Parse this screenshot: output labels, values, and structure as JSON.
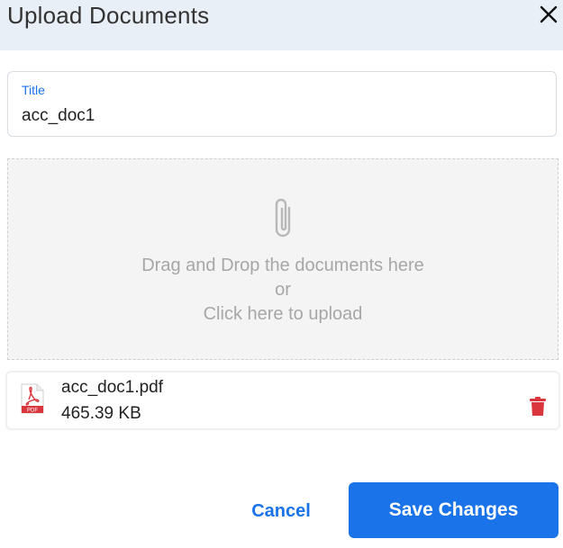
{
  "dialog": {
    "title": "Upload Documents",
    "close_icon": "close-icon"
  },
  "title_field": {
    "label": "Title",
    "value": "acc_doc1"
  },
  "dropzone": {
    "icon": "paperclip-icon",
    "line1": "Drag and Drop the documents here",
    "line2": "or",
    "line3": "Click here to upload"
  },
  "file": {
    "icon": "pdf-file-icon",
    "name": "acc_doc1.pdf",
    "size": "465.39 KB",
    "delete_icon": "trash-icon"
  },
  "actions": {
    "cancel_label": "Cancel",
    "save_label": "Save Changes"
  },
  "colors": {
    "accent": "#1a73e8",
    "header_bg": "#e9eff7",
    "danger": "#d9363e"
  }
}
